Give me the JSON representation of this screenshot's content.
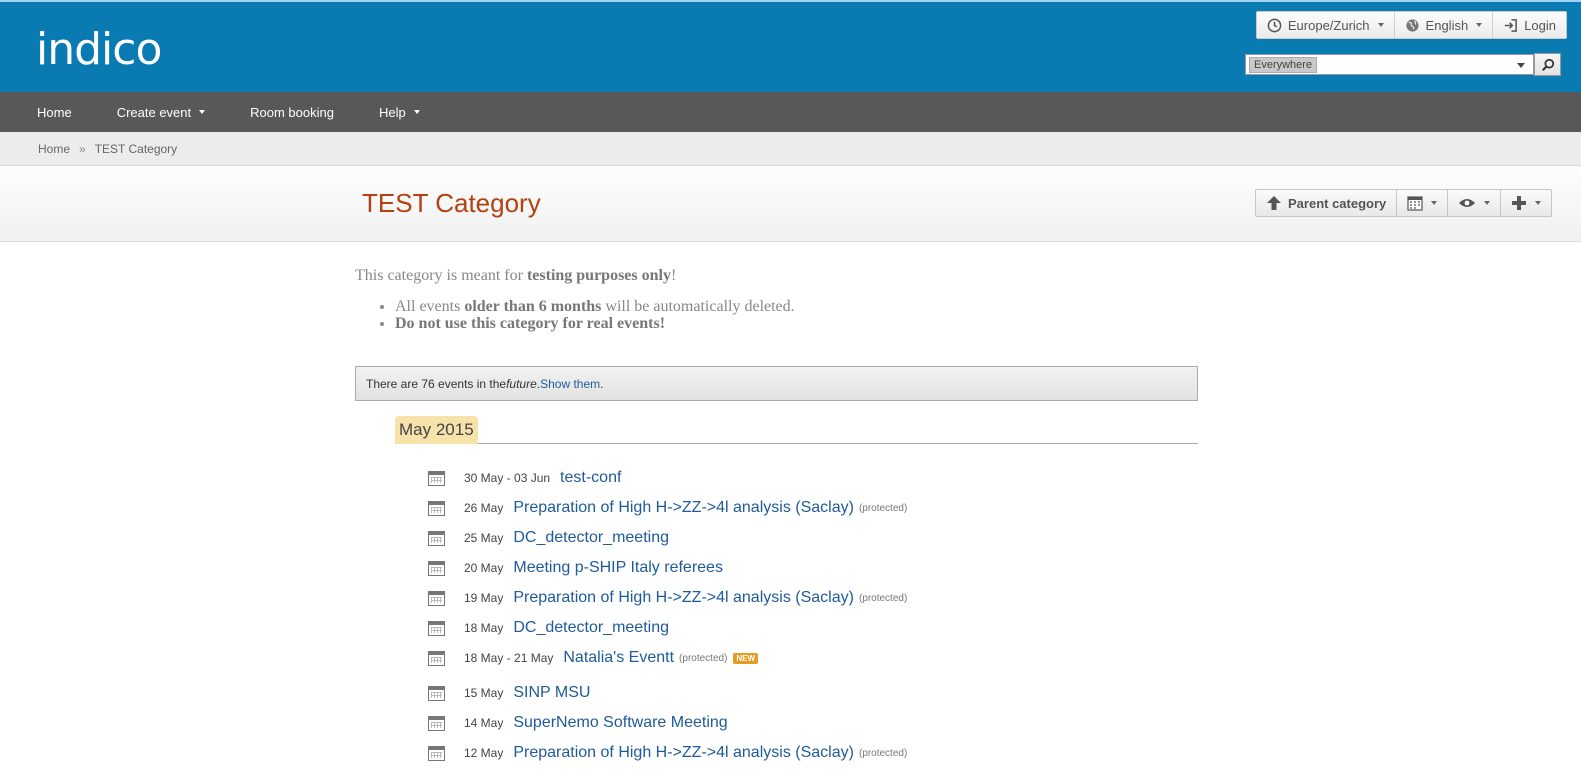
{
  "header": {
    "logo_text": "indico",
    "timezone_label": "Europe/Zurich",
    "language_label": "English",
    "login_label": "Login",
    "search_scope": "Everywhere",
    "search_placeholder": ""
  },
  "nav": {
    "items": [
      {
        "label": "Home",
        "has_menu": false
      },
      {
        "label": "Create event",
        "has_menu": true
      },
      {
        "label": "Room booking",
        "has_menu": false
      },
      {
        "label": "Help",
        "has_menu": true
      }
    ]
  },
  "breadcrumb": [
    "Home",
    "TEST Category"
  ],
  "breadcrumb_separator": "»",
  "page": {
    "title": "TEST Category",
    "toolbar": {
      "parent_category_label": "Parent category"
    }
  },
  "description": {
    "intro_prefix": "This category is meant for ",
    "intro_bold": "testing purposes only",
    "intro_suffix": "!",
    "bullet1_prefix": "All events ",
    "bullet1_bold": "older than 6 months",
    "bullet1_suffix": " will be automatically deleted.",
    "bullet2": "Do not use this category for real events!"
  },
  "notice": {
    "text_prefix": "There are 76 events in the ",
    "text_italic": "future",
    "text_after": ". ",
    "link_label": "Show them",
    "text_end": "."
  },
  "month": "May 2015",
  "events": [
    {
      "date": "30 May - 03 Jun",
      "title": "test-conf",
      "protected": "",
      "new": ""
    },
    {
      "date": "26 May",
      "title": "Preparation of High H->ZZ->4l analysis (Saclay)",
      "protected": "(protected)",
      "new": ""
    },
    {
      "date": "25 May",
      "title": "DC_detector_meeting",
      "protected": "",
      "new": ""
    },
    {
      "date": "20 May",
      "title": "Meeting p-SHIP Italy referees",
      "protected": "",
      "new": ""
    },
    {
      "date": "19 May",
      "title": "Preparation of High H->ZZ->4l analysis (Saclay)",
      "protected": "(protected)",
      "new": ""
    },
    {
      "date": "18 May",
      "title": "DC_detector_meeting",
      "protected": "",
      "new": ""
    },
    {
      "date": "18 May - 21 May",
      "title": "Natalia's Eventt",
      "protected": "(protected)",
      "new": "NEW"
    },
    {
      "date": "15 May",
      "title": "SINP MSU",
      "protected": "",
      "new": ""
    },
    {
      "date": "14 May",
      "title": "SuperNemo Software Meeting",
      "protected": "",
      "new": ""
    },
    {
      "date": "12 May",
      "title": "Preparation of High H->ZZ->4l analysis (Saclay)",
      "protected": "(protected)",
      "new": ""
    }
  ],
  "colors": {
    "header_bg": "#0a7ab3",
    "nav_bg": "#585858",
    "title": "#b34210",
    "link": "#1f5a9a",
    "month_bg": "#f7e3a9",
    "new_badge": "#e69b22"
  }
}
